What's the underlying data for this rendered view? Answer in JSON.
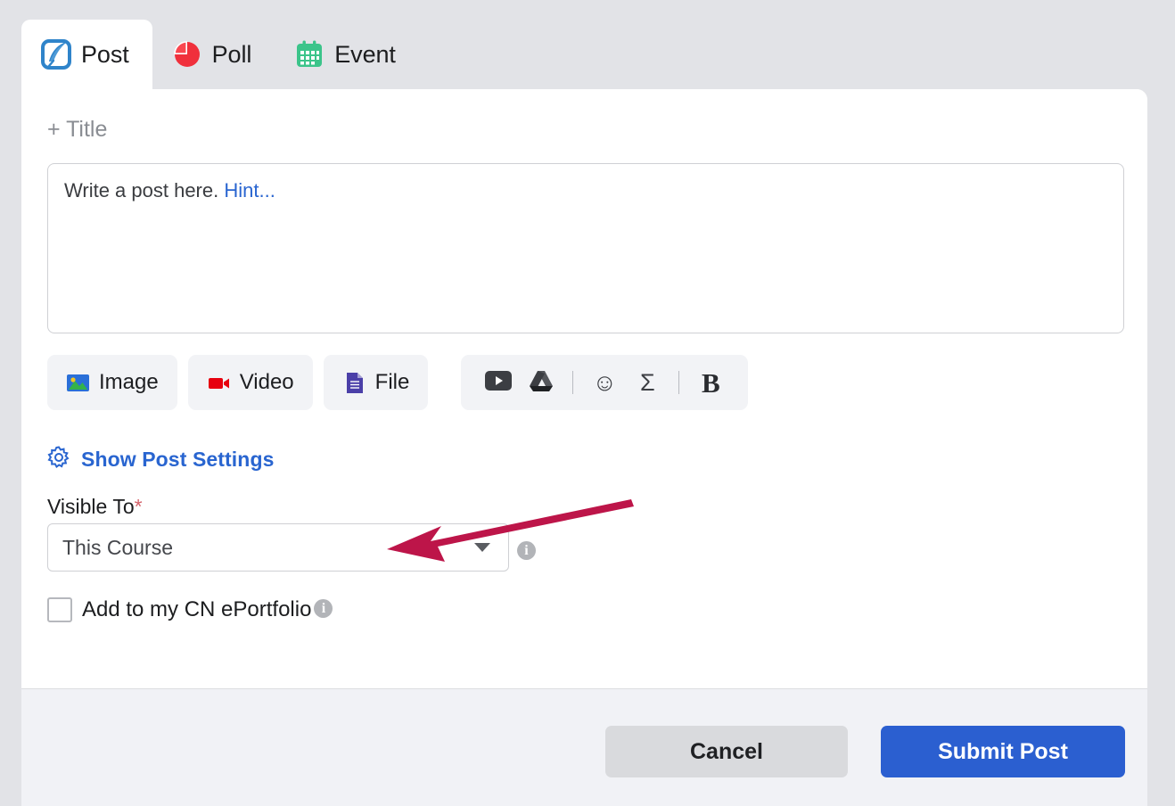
{
  "tabs": [
    {
      "id": "post",
      "label": "Post",
      "icon": "post-quill-icon",
      "active": true
    },
    {
      "id": "poll",
      "label": "Poll",
      "icon": "pie-chart-icon",
      "active": false
    },
    {
      "id": "event",
      "label": "Event",
      "icon": "calendar-icon",
      "active": false
    }
  ],
  "composer": {
    "title_placeholder": "+ Title",
    "body_placeholder": "Write a post here.",
    "body_hint_link": "Hint..."
  },
  "media_toolbar": [
    {
      "id": "image",
      "label": "Image",
      "icon": "image-icon"
    },
    {
      "id": "video",
      "label": "Video",
      "icon": "video-icon"
    },
    {
      "id": "file",
      "label": "File",
      "icon": "file-icon"
    }
  ],
  "rich_toolbar": [
    {
      "id": "youtube",
      "icon": "youtube-icon",
      "glyph": ""
    },
    {
      "id": "google-drive",
      "icon": "google-drive-icon",
      "glyph": ""
    },
    {
      "id": "separator-1",
      "icon": "separator",
      "glyph": ""
    },
    {
      "id": "emoji",
      "icon": "smiley-icon",
      "glyph": "☺"
    },
    {
      "id": "equation",
      "icon": "sigma-icon",
      "glyph": "Σ"
    },
    {
      "id": "separator-2",
      "icon": "separator",
      "glyph": ""
    },
    {
      "id": "bold",
      "icon": "bold-icon",
      "glyph": "B"
    }
  ],
  "settings": {
    "show_settings_label": "Show Post Settings",
    "gear_icon": "gear-icon",
    "visible_to_label": "Visible To",
    "visible_to_required_mark": "*",
    "visible_to_value": "This Course",
    "visible_to_info_icon": "info-icon",
    "eportfolio_label": "Add to my CN ePortfolio",
    "eportfolio_info_icon": "info-icon",
    "eportfolio_checked": false
  },
  "footer": {
    "cancel_label": "Cancel",
    "submit_label": "Submit Post"
  },
  "colors": {
    "page_background": "#e2e3e7",
    "card_background": "#ffffff",
    "footer_background": "#f1f2f6",
    "accent_blue": "#2965d0",
    "submit_blue": "#2b5fd0",
    "cancel_gray": "#d9dadd",
    "annotation_crimson": "#bd1549",
    "required_red": "#d4636b",
    "poll_red": "#f0303c",
    "event_green": "#3bc48a",
    "video_red": "#e7000f",
    "file_purple": "#4b3fa8"
  },
  "annotation": {
    "type": "arrow",
    "description": "crimson arrow pointing to the Visible To dropdown",
    "color": "#bd1549"
  }
}
